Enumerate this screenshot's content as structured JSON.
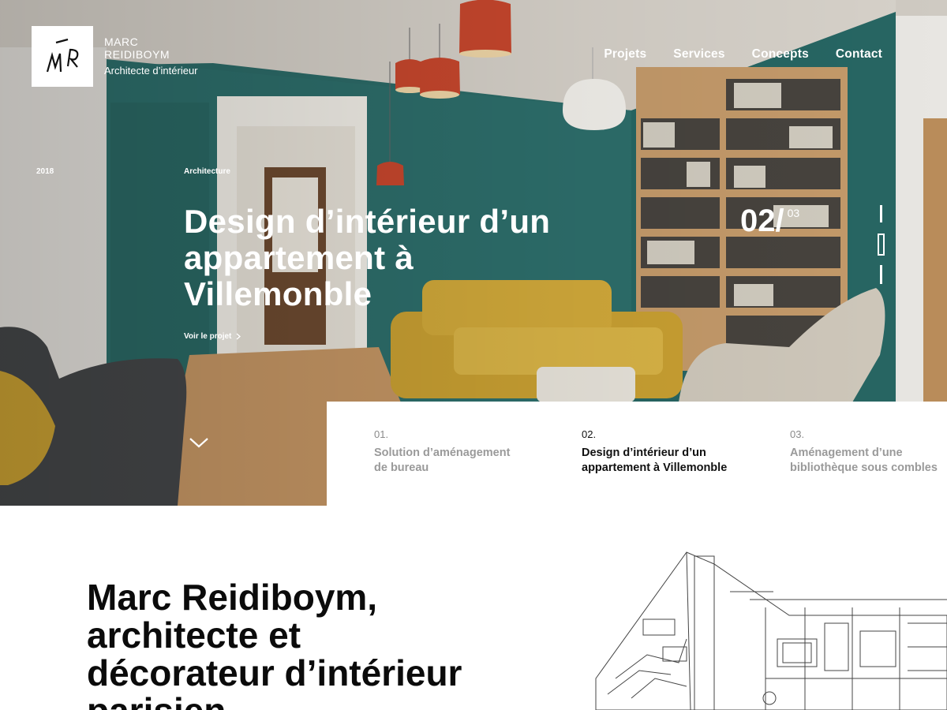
{
  "logo": {
    "initials": "MR",
    "name_line1": "Marc",
    "name_line2": "Reidiboym",
    "role": "Architecte d’intérieur"
  },
  "nav": [
    {
      "label": "Projets"
    },
    {
      "label": "Services"
    },
    {
      "label": "Concepts"
    },
    {
      "label": "Contact"
    }
  ],
  "hero": {
    "year": "2018",
    "category": "Architecture",
    "title": "Design d’intérieur d’un appartement à Villemonble",
    "cta": "Voir le projet",
    "cta_icon": "chevron-right-icon",
    "counter_current": "02/",
    "counter_total": "03",
    "scroll_icon": "chevron-down-icon"
  },
  "slides": [
    {
      "num": "01.",
      "title": "Solution d’aménagement de bureau",
      "active": false
    },
    {
      "num": "02.",
      "title": "Design d’intérieur d’un appartement à Villemonble",
      "active": true
    },
    {
      "num": "03.",
      "title": "Aménagement d’une bibliothèque sous combles",
      "active": false
    }
  ],
  "about": {
    "title": "Marc Reidiboym, architecte et décorateur d’intérieur parisien"
  },
  "colors": {
    "wall_teal": "#2c6b68",
    "sofa_yellow": "#d1a93a",
    "lamp_red": "#c8472d",
    "text_white": "#ffffff"
  }
}
